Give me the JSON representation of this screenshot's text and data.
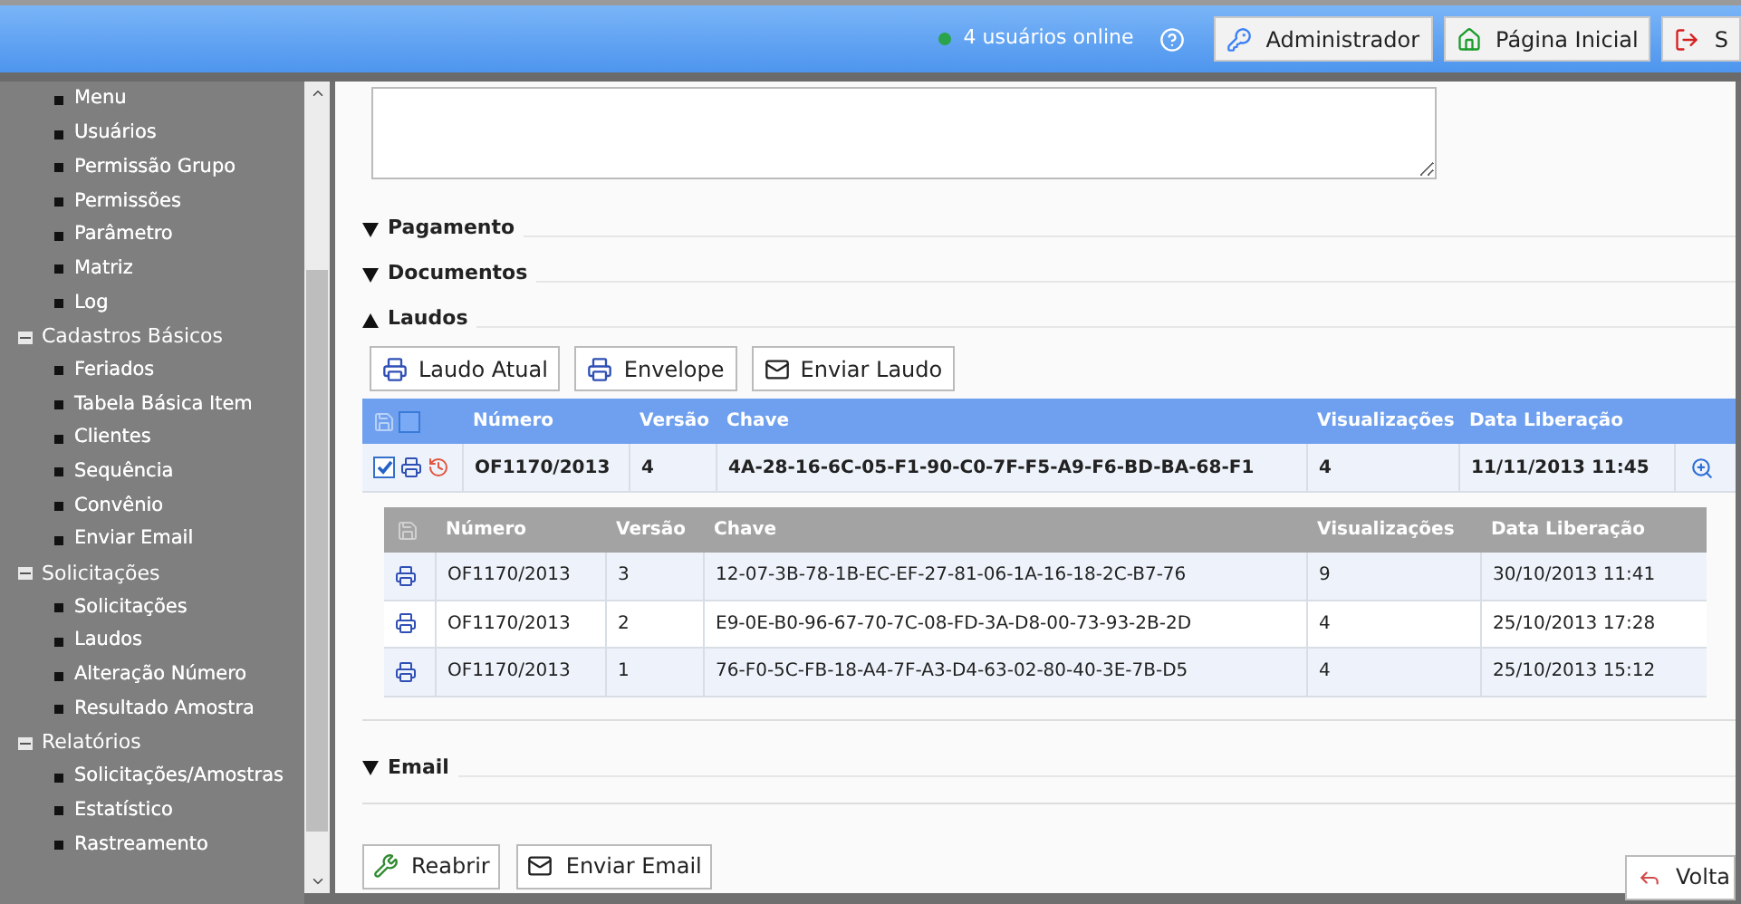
{
  "header": {
    "online_text": "4 usuários online",
    "buttons": [
      {
        "label": "Administrador"
      },
      {
        "label": "Página Inicial"
      },
      {
        "label": "S"
      }
    ]
  },
  "sidebar": {
    "items": [
      {
        "label": "Menu"
      },
      {
        "label": "Usuários"
      },
      {
        "label": "Permissão Grupo"
      },
      {
        "label": "Permissões"
      },
      {
        "label": "Parâmetro"
      },
      {
        "label": "Matriz"
      },
      {
        "label": "Log"
      },
      {
        "label": "Cadastros Básicos",
        "expanded": true,
        "children": [
          {
            "label": "Feriados"
          },
          {
            "label": "Tabela Básica Item"
          },
          {
            "label": "Clientes"
          },
          {
            "label": "Sequência"
          },
          {
            "label": "Convênio"
          },
          {
            "label": "Enviar Email"
          }
        ]
      },
      {
        "label": "Solicitações",
        "expanded": true,
        "children": [
          {
            "label": "Solicitações"
          },
          {
            "label": "Laudos"
          },
          {
            "label": "Alteração Número"
          },
          {
            "label": "Resultado Amostra"
          }
        ]
      },
      {
        "label": "Relatórios",
        "expanded": true,
        "children": [
          {
            "label": "Solicitações/Amostras"
          },
          {
            "label": "Estatístico"
          },
          {
            "label": "Rastreamento"
          }
        ]
      }
    ]
  },
  "sections": [
    {
      "title": "Pagamento",
      "expanded": false
    },
    {
      "title": "Documentos",
      "expanded": false
    },
    {
      "title": "Laudos",
      "expanded": true,
      "buttons": [
        "Laudo Atual",
        "Envelope",
        "Enviar Laudo"
      ],
      "table": {
        "select_all_checked": false,
        "columns": [
          "Número",
          "Versão",
          "Chave",
          "Visualizações",
          "Data Liberação"
        ],
        "rows": [
          {
            "checked": true,
            "expanded": true,
            "cells": [
              "OF1170/2013",
              "4",
              "4A-28-16-6C-05-F1-90-C0-7F-F5-A9-F6-BD-BA-68-F1",
              "4",
              "11/11/2013 11:45"
            ],
            "history": {
              "columns": [
                "Número",
                "Versão",
                "Chave",
                "Visualizações",
                "Data Liberação"
              ],
              "rows": [
                [
                  "OF1170/2013",
                  "3",
                  "12-07-3B-78-1B-EC-EF-27-81-06-1A-16-18-2C-B7-76",
                  "9",
                  "30/10/2013 11:41"
                ],
                [
                  "OF1170/2013",
                  "2",
                  "E9-0E-B0-96-67-70-7C-08-FD-3A-D8-00-73-93-2B-2D",
                  "4",
                  "25/10/2013 17:28"
                ],
                [
                  "OF1170/2013",
                  "1",
                  "76-F0-5C-FB-18-A4-7F-A3-D4-63-02-80-40-3E-7B-D5",
                  "4",
                  "25/10/2013 15:12"
                ]
              ]
            }
          }
        ]
      }
    },
    {
      "title": "Email",
      "expanded": false
    }
  ],
  "actions": [
    "Reabrir",
    "Enviar Email"
  ],
  "back_button": "Volta"
}
